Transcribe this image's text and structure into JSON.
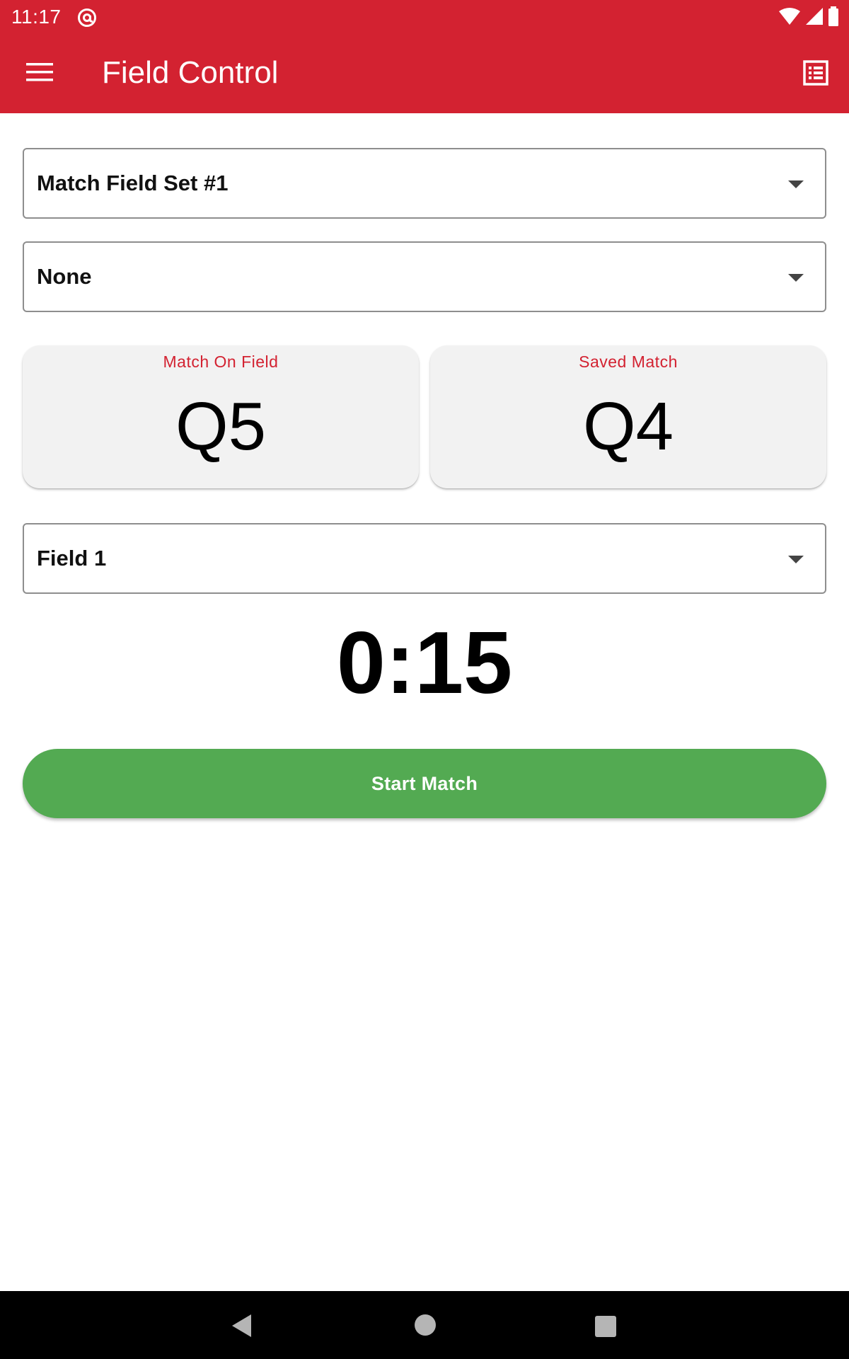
{
  "status_bar": {
    "time": "11:17",
    "icons": [
      "at-sign-icon",
      "wifi-icon",
      "cellular-signal-icon",
      "battery-icon"
    ]
  },
  "app_bar": {
    "title": "Field Control",
    "menu_icon": "hamburger-menu-icon",
    "action_icon": "list-view-icon",
    "background_color": "#d32231"
  },
  "match_field_set_select": {
    "selected": "Match Field Set #1"
  },
  "secondary_select": {
    "selected": "None"
  },
  "cards": {
    "match_on_field": {
      "label": "Match On Field",
      "value": "Q5"
    },
    "saved_match": {
      "label": "Saved Match",
      "value": "Q4"
    }
  },
  "field_select": {
    "selected": "Field 1"
  },
  "timer": {
    "value": "0:15"
  },
  "start_button": {
    "label": "Start Match",
    "color": "#53aa52"
  },
  "nav_bar": {
    "icons": [
      "back-icon",
      "home-icon",
      "recents-icon"
    ]
  }
}
